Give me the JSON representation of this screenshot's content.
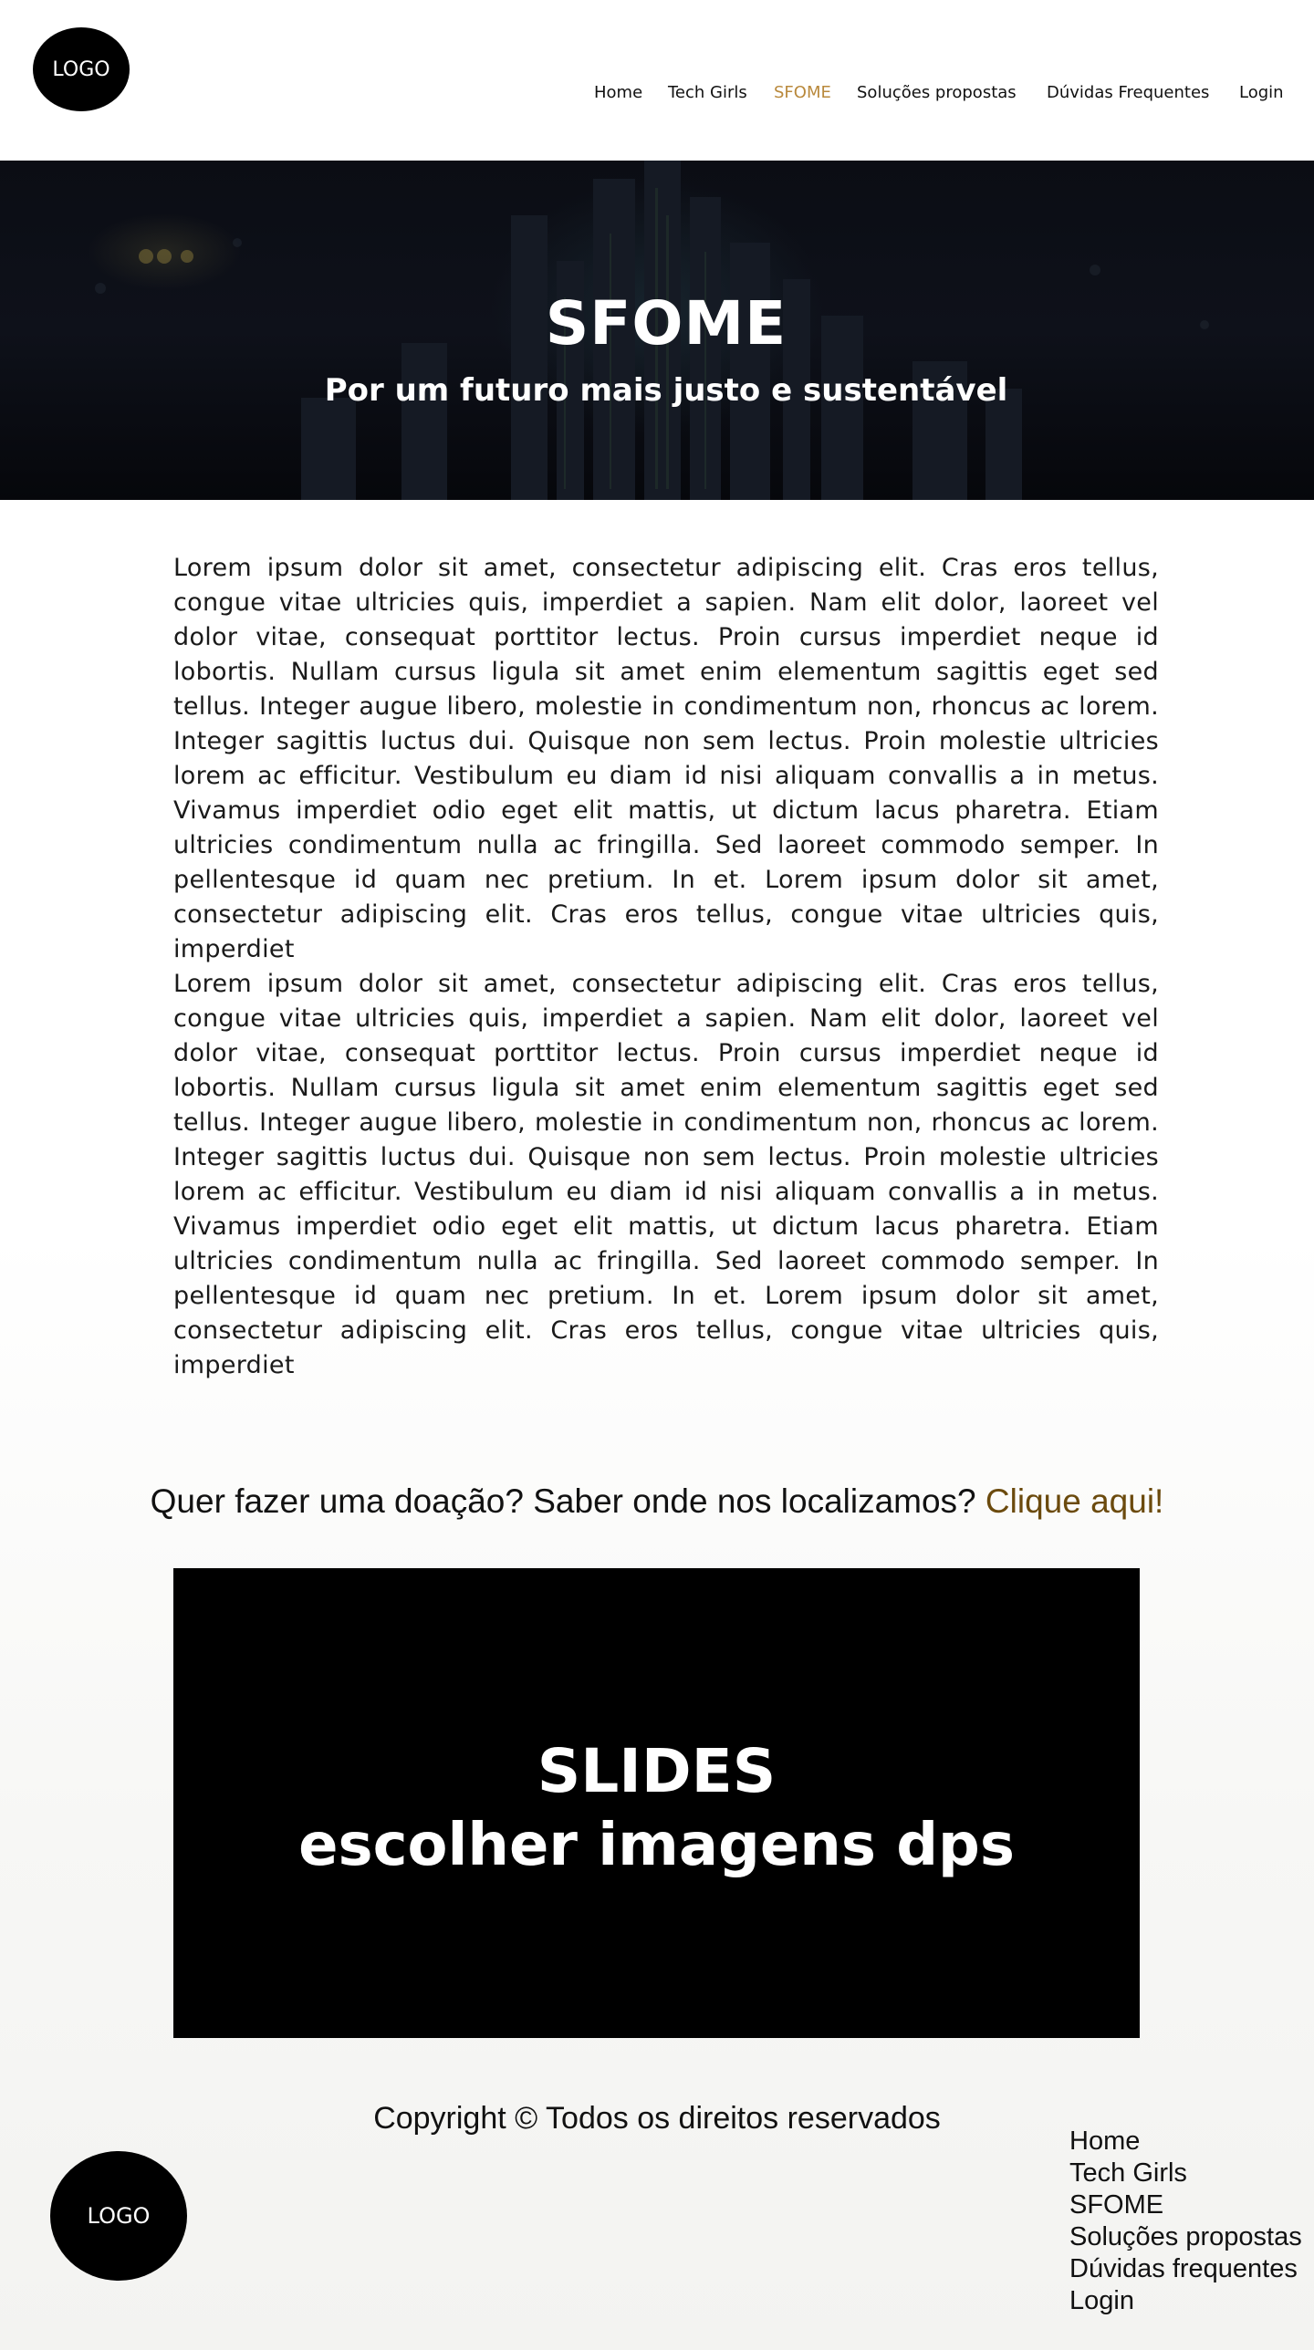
{
  "header": {
    "logo_text": "LOGO",
    "nav": [
      {
        "label": "Home"
      },
      {
        "label": "Tech Girls"
      },
      {
        "label": "SFOME",
        "active": true
      },
      {
        "label": "Soluções propostas"
      },
      {
        "label": "Dúvidas Frequentes"
      },
      {
        "label": "Login"
      }
    ],
    "active_color": "#b9893c"
  },
  "hero": {
    "title": "SFOME",
    "subtitle": "Por um futuro mais justo e sustentável"
  },
  "content": {
    "paragraphs": [
      "Lorem ipsum dolor sit amet, consectetur adipiscing elit. Cras eros tellus, congue vitae ultricies quis, imperdiet a sapien. Nam elit dolor, laoreet vel dolor vitae, consequat porttitor lectus. Proin cursus imperdiet neque id lobortis. Nullam cursus ligula sit amet enim elementum sagittis eget sed tellus. Integer augue libero, molestie in condimentum non, rhoncus ac lorem. Integer sagittis luctus dui. Quisque non sem lectus. Proin molestie ultricies lorem ac efficitur. Vestibulum eu diam id nisi aliquam convallis a in metus. Vivamus imperdiet odio eget elit mattis, ut dictum lacus pharetra. Etiam ultricies condimentum nulla ac fringilla. Sed laoreet commodo semper. In pellentesque id quam nec pretium. In et. Lorem ipsum dolor sit amet, consectetur adipiscing elit. Cras eros tellus, congue vitae ultricies quis, imperdiet",
      "Lorem ipsum dolor sit amet, consectetur adipiscing elit. Cras eros tellus, congue vitae ultricies quis, imperdiet a sapien. Nam elit dolor, laoreet vel dolor vitae, consequat porttitor lectus. Proin cursus imperdiet neque id lobortis. Nullam cursus ligula sit amet enim elementum sagittis eget sed tellus. Integer augue libero, molestie in condimentum non, rhoncus ac lorem. Integer sagittis luctus dui. Quisque non sem lectus. Proin molestie ultricies lorem ac efficitur. Vestibulum eu diam id nisi aliquam convallis a in metus. Vivamus imperdiet odio eget elit mattis, ut dictum lacus pharetra. Etiam ultricies condimentum nulla ac fringilla. Sed laoreet commodo semper. In pellentesque id quam nec pretium. In et. Lorem ipsum dolor sit amet, consectetur adipiscing elit. Cras eros tellus, congue vitae ultricies quis, imperdiet"
    ]
  },
  "cta": {
    "text": "Quer fazer uma doação? Saber onde nos localizamos? ",
    "link_label": "Clique aqui!",
    "link_color": "#6b4a0d"
  },
  "slides": {
    "title": "SLIDES",
    "subtitle": "escolher imagens dps"
  },
  "footer": {
    "copyright": "Copyright © Todos os direitos reservados",
    "logo_text": "LOGO",
    "nav": [
      {
        "label": "Home"
      },
      {
        "label": "Tech Girls"
      },
      {
        "label": "SFOME"
      },
      {
        "label": "Soluções propostas"
      },
      {
        "label": "Dúvidas frequentes"
      },
      {
        "label": "Login"
      }
    ]
  }
}
